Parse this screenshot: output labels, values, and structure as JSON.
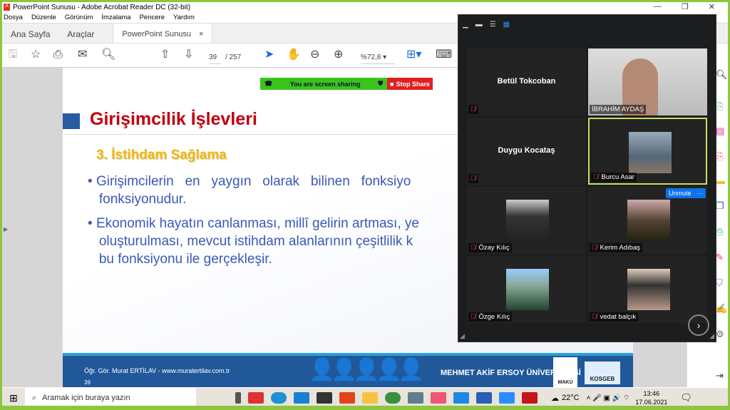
{
  "window": {
    "title": "PowerPoint Sunusu - Adobe Acrobat Reader DC (32-bit)"
  },
  "menu": [
    "Dosya",
    "Düzenle",
    "Görünüm",
    "İmzalama",
    "Pencere",
    "Yardım"
  ],
  "tabs": {
    "home": "Ana Sayfa",
    "tools": "Araçlar",
    "doc": "PowerPoint Sunusu",
    "close": "×"
  },
  "toolbar": {
    "page": "39",
    "total": "/  257",
    "zoom": "%72,8"
  },
  "slide": {
    "title": "Girişimcilik İşlevleri",
    "subtitle": "3. İstihdam Sağlama",
    "bullet1": [
      "Girişimcilerin   en   yaygın   olarak   bilinen   fonksiyo",
      "fonksiyonudur."
    ],
    "bullet2": [
      "Ekonomik hayatın canlanması, millî gelirin artması, ye",
      "oluşturulması, mevcut istihdam alanlarının çeşitlilik k",
      "bu fonksiyonu ile gerçekleşir."
    ],
    "footer_author": "Öğr. Gör. Murat ERTİLAV  -  www.muratertilav.com.tr",
    "footer_page": "39",
    "university": "MEHMET AKİF ERSOY ÜNİVERSİTESİ",
    "logo1": "MAKÜ",
    "logo2": "KOSGEB"
  },
  "share": {
    "status": "You are screen sharing",
    "stop": "Stop Share"
  },
  "zoom": {
    "participants": [
      {
        "name": "Betül Tokcoban",
        "video": false
      },
      {
        "name": "İBRAHİM AYDAŞ",
        "video": true
      },
      {
        "name": "Duygu Kocataş",
        "video": false
      },
      {
        "name": "Burcu Asar",
        "video": true
      },
      {
        "name": "Özay Kılıç",
        "video": true
      },
      {
        "name": "Kerim Adıbaş",
        "video": true
      },
      {
        "name": "Özge Kılıç",
        "video": true
      },
      {
        "name": "vedat balçık",
        "video": true
      }
    ],
    "unmute": "Unmute",
    "more": "···"
  },
  "taskbar": {
    "search": "Aramak için buraya yazın",
    "weather": "22°C",
    "time": "13:46",
    "date": "17.06.2021"
  }
}
